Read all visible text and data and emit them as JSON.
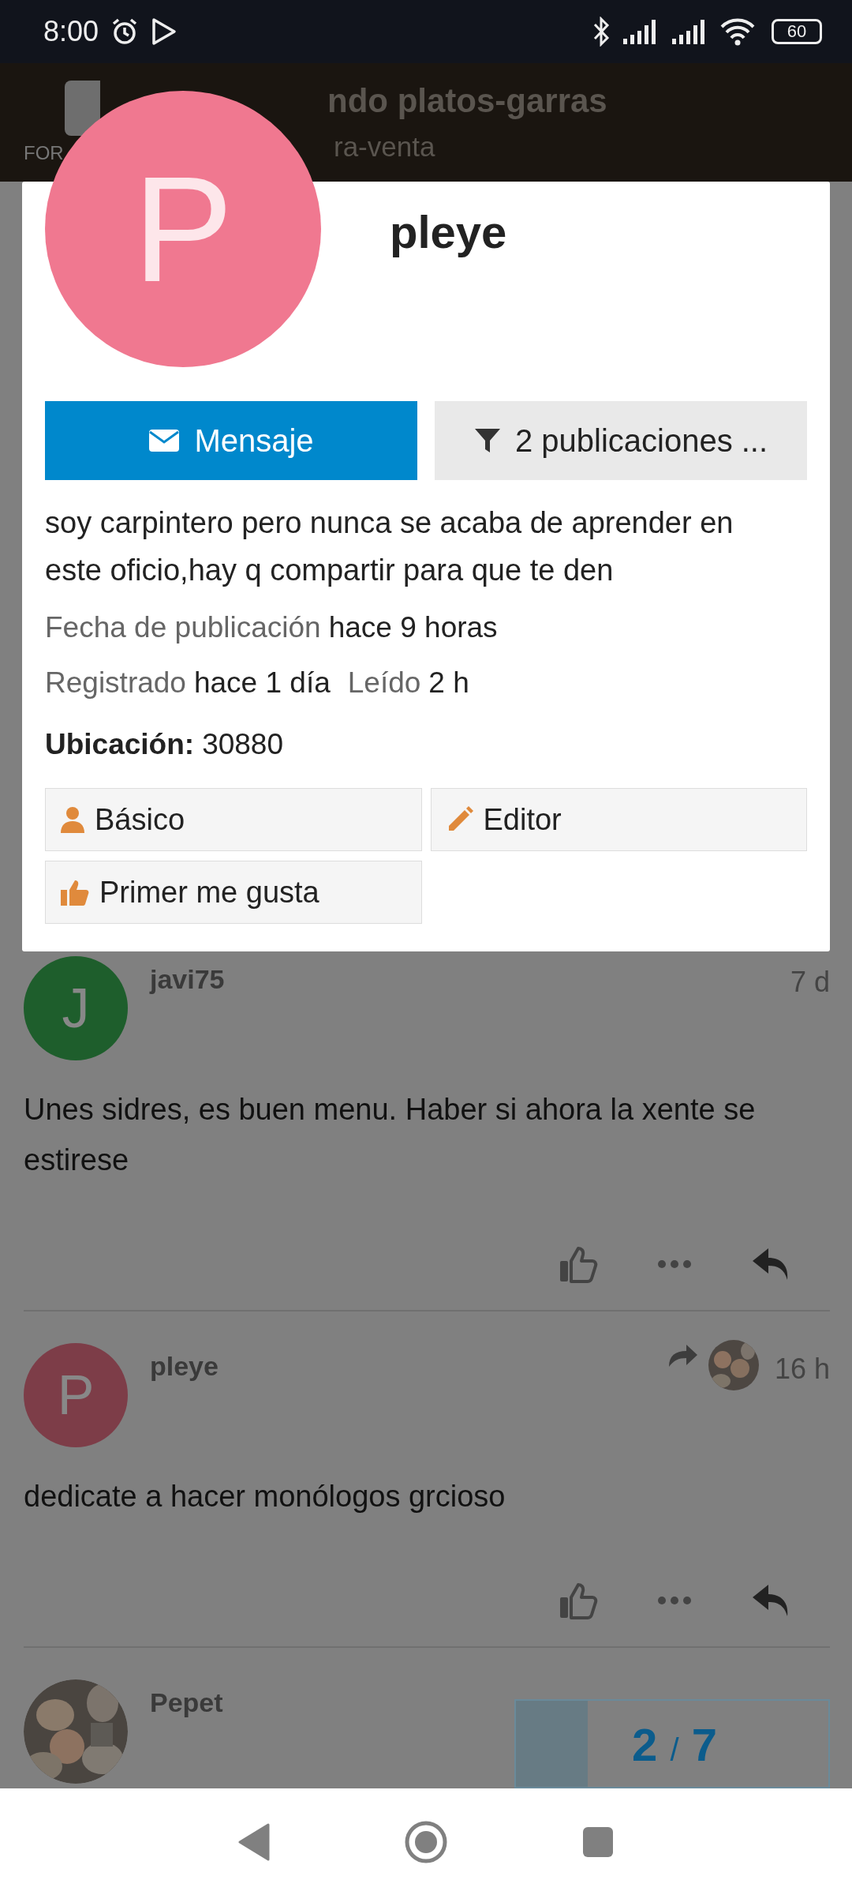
{
  "status_bar": {
    "time": "8:00",
    "battery": "60"
  },
  "header": {
    "logo_text": "FOR",
    "title": "ndo platos-garras",
    "subtitle": "ra-venta"
  },
  "user_card": {
    "avatar_letter": "P",
    "username": "pleye",
    "buttons": [
      {
        "kind": "message",
        "label": "Mensaje"
      },
      {
        "kind": "filter",
        "label": "2 publicaciones ..."
      }
    ],
    "bio": "soy carpintero pero nunca se acaba de aprender en este oficio,hay q compartir para que te den",
    "stat_lines": [
      [
        {
          "label": "Fecha de publicación",
          "value": "hace 9 horas"
        }
      ],
      [
        {
          "label": "Registrado",
          "value": "hace 1 día"
        },
        {
          "label": "Leído",
          "value": "2 h"
        }
      ]
    ],
    "location": {
      "label": "Ubicación:",
      "value": "30880"
    },
    "badges": [
      {
        "kind": "person",
        "label": "Básico"
      },
      {
        "kind": "pencil",
        "label": "Editor"
      },
      {
        "kind": "thumb",
        "label": "Primer me gusta"
      }
    ]
  },
  "posts": [
    {
      "author": "javi75",
      "avatar": {
        "kind": "letter",
        "letter": "J",
        "color": "#1e5e2c"
      },
      "time": "7 d",
      "reply_to": false,
      "text": "Unes sidres, es buen menu. Haber si ahora la xente se estirese"
    },
    {
      "author": "pleye",
      "avatar": {
        "kind": "letter",
        "letter": "P",
        "color": "#7d3d48"
      },
      "time": "16 h",
      "reply_to": true,
      "text": "dedicate a hacer monólogos grcioso"
    },
    {
      "author": "Pepet"
    }
  ],
  "progress": {
    "current": "2",
    "separator": "/",
    "total": "7",
    "level": 0.23
  }
}
